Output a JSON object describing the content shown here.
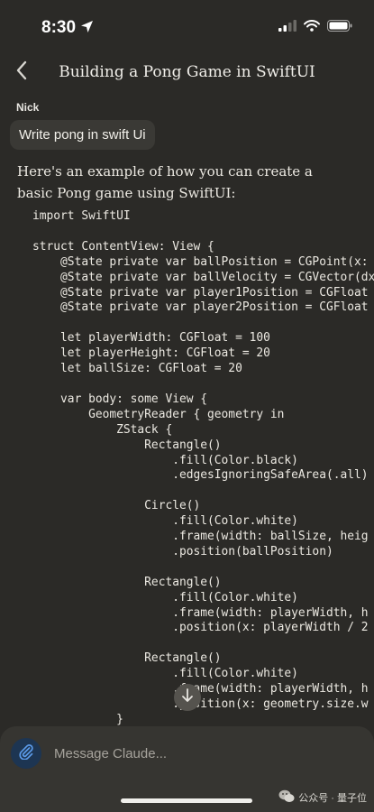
{
  "status_bar": {
    "time": "8:30"
  },
  "nav": {
    "title": "Building a Pong Game in SwiftUI"
  },
  "conversation": {
    "user_name": "Nick",
    "user_message": "Write pong in swift Ui",
    "assistant_intro": "Here's an example of how you can create a basic Pong game using SwiftUI:",
    "code_lines": [
      "import SwiftUI",
      "",
      "struct ContentView: View {",
      "    @State private var ballPosition = CGPoint(x:",
      "    @State private var ballVelocity = CGVector(dx",
      "    @State private var player1Position = CGFloat",
      "    @State private var player2Position = CGFloat",
      "",
      "    let playerWidth: CGFloat = 100",
      "    let playerHeight: CGFloat = 20",
      "    let ballSize: CGFloat = 20",
      "",
      "    var body: some View {",
      "        GeometryReader { geometry in",
      "            ZStack {",
      "                Rectangle()",
      "                    .fill(Color.black)",
      "                    .edgesIgnoringSafeArea(.all)",
      "",
      "                Circle()",
      "                    .fill(Color.white)",
      "                    .frame(width: ballSize, heig",
      "                    .position(ballPosition)",
      "",
      "                Rectangle()",
      "                    .fill(Color.white)",
      "                    .frame(width: playerWidth, h",
      "                    .position(x: playerWidth / 2",
      "",
      "                Rectangle()",
      "                    .fill(Color.white)",
      "                    .frame(width: playerWidth, h",
      "                    .position(x: geometry.size.w",
      "            }"
    ]
  },
  "composer": {
    "placeholder": "Message Claude..."
  },
  "watermark": {
    "text": "公众号 · 量子位"
  },
  "icons": {
    "location": "location-arrow-icon",
    "signal": "cellular-signal-icon",
    "wifi": "wifi-icon",
    "battery": "battery-icon",
    "back": "chevron-left-icon",
    "scroll_down": "arrow-down-icon",
    "attach": "paperclip-icon",
    "wechat": "wechat-icon"
  },
  "colors": {
    "background": "#2b2a27",
    "user_bubble": "#3a3935",
    "composer": "#363531",
    "attach_button": "#1d3552",
    "attach_icon": "#5b9ae8"
  }
}
